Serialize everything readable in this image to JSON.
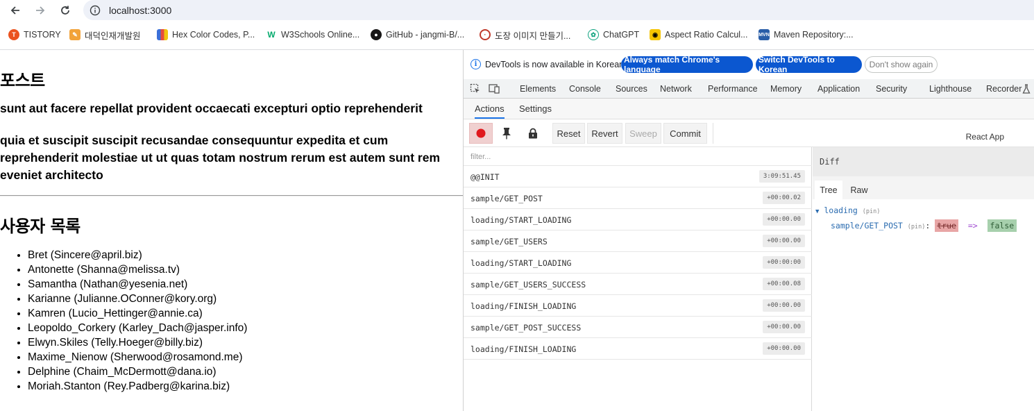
{
  "browser": {
    "url": "localhost:3000",
    "bookmarks": [
      {
        "label": "TISTORY",
        "icon": "tistory-icon",
        "color": "#eb531f"
      },
      {
        "label": "대덕인재개발원",
        "icon": "ddit-icon",
        "color": "#f2a33a"
      },
      {
        "label": "Hex Color Codes, P...",
        "icon": "hex-color-icon",
        "color": "#3b6fd8"
      },
      {
        "label": "W3Schools Online...",
        "icon": "w3schools-icon",
        "color": "#04aa6d"
      },
      {
        "label": "GitHub - jangmi-B/...",
        "icon": "github-icon",
        "color": "#181717"
      },
      {
        "label": "도장 이미지 만들기...",
        "icon": "stamp-icon",
        "color": "#c0392b"
      },
      {
        "label": "ChatGPT",
        "icon": "chatgpt-icon",
        "color": "#10a37f"
      },
      {
        "label": "Aspect Ratio Calcul...",
        "icon": "aspect-ratio-icon",
        "color": "#d6a500"
      },
      {
        "label": "Maven Repository:...",
        "icon": "maven-icon",
        "color": "#2a5ea8"
      }
    ]
  },
  "page": {
    "post_heading": "포스트",
    "post_title": "sunt aut facere repellat provident occaecati excepturi optio reprehenderit",
    "post_body": "quia et suscipit suscipit recusandae consequuntur expedita et cum reprehenderit molestiae ut ut quas totam nostrum rerum est autem sunt rem eveniet architecto",
    "users_heading": "사용자 목록",
    "users": [
      "Bret (Sincere@april.biz)",
      "Antonette (Shanna@melissa.tv)",
      "Samantha (Nathan@yesenia.net)",
      "Karianne (Julianne.OConner@kory.org)",
      "Kamren (Lucio_Hettinger@annie.ca)",
      "Leopoldo_Corkery (Karley_Dach@jasper.info)",
      "Elwyn.Skiles (Telly.Hoeger@billy.biz)",
      "Maxime_Nienow (Sherwood@rosamond.me)",
      "Delphine (Chaim_McDermott@dana.io)",
      "Moriah.Stanton (Rey.Padberg@karina.biz)"
    ]
  },
  "devtools": {
    "infobar": {
      "message": "DevTools is now available in Korean!",
      "match_language": "Always match Chrome's language",
      "switch_korean": "Switch DevTools to Korean",
      "dont_show": "Don't show again"
    },
    "tabs": [
      "Elements",
      "Console",
      "Sources",
      "Network",
      "Performance",
      "Memory",
      "Application",
      "Security",
      "Lighthouse",
      "Recorder"
    ],
    "redux": {
      "tabs": [
        "Actions",
        "Settings"
      ],
      "active_tab": "Actions",
      "buttons": {
        "reset": "Reset",
        "revert": "Revert",
        "sweep": "Sweep",
        "commit": "Commit"
      },
      "app_name": "React App",
      "filter_placeholder": "filter...",
      "actions": [
        {
          "name": "@@INIT",
          "time": "3:09:51.45"
        },
        {
          "name": "sample/GET_POST",
          "time": "+00:00.02"
        },
        {
          "name": "loading/START_LOADING",
          "time": "+00:00.00"
        },
        {
          "name": "sample/GET_USERS",
          "time": "+00:00.00"
        },
        {
          "name": "loading/START_LOADING",
          "time": "+00:00:00"
        },
        {
          "name": "sample/GET_USERS_SUCCESS",
          "time": "+00:00.08"
        },
        {
          "name": "loading/FINISH_LOADING",
          "time": "+00:00.00"
        },
        {
          "name": "sample/GET_POST_SUCCESS",
          "time": "+00:00.00"
        },
        {
          "name": "loading/FINISH_LOADING",
          "time": "+00:00.00"
        }
      ],
      "diff": {
        "header": "Diff",
        "tabs": [
          "Tree",
          "Raw"
        ],
        "active_tab": "Tree",
        "root_key": "loading",
        "root_pin": "(pin)",
        "child_key": "sample/GET_POST",
        "child_pin": "(pin)",
        "old_value": "true",
        "arrow": "=>",
        "new_value": "false"
      }
    }
  }
}
